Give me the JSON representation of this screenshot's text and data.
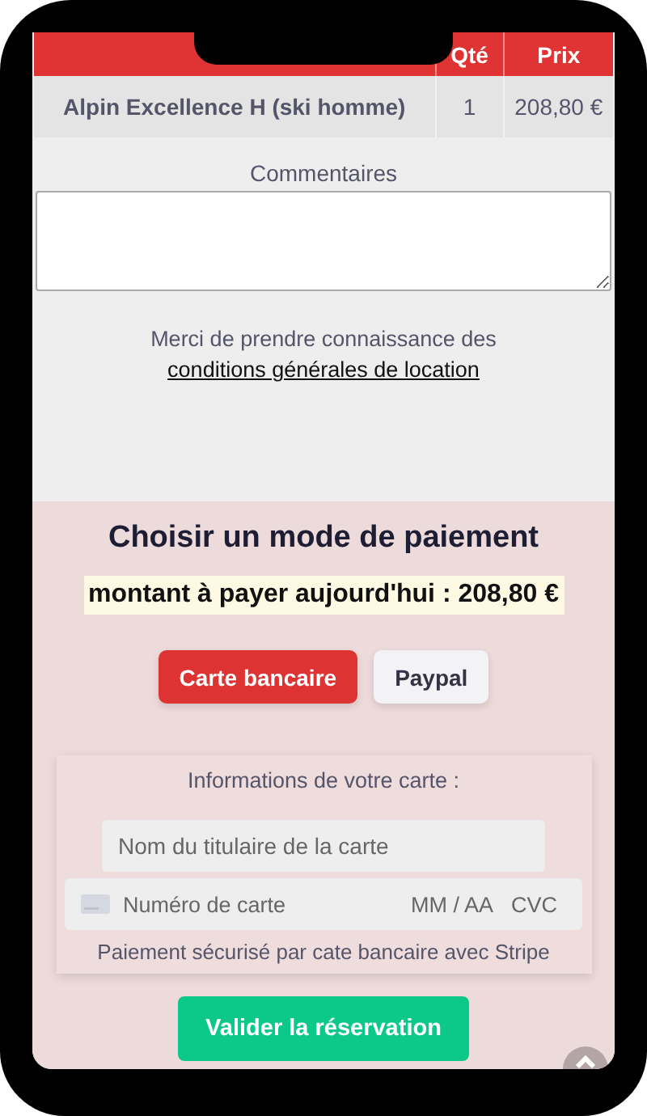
{
  "order_table": {
    "columns": [
      "Qté",
      "Prix"
    ],
    "rows": [
      {
        "product": "Alpin Excellence H (ski homme)",
        "quantity": "1",
        "price": "208,80 €"
      }
    ]
  },
  "comments": {
    "label": "Commentaires"
  },
  "terms": {
    "text": "Merci de prendre connaissance des",
    "link": "conditions générales de location"
  },
  "payment": {
    "title": "Choisir un mode de paiement",
    "amount": "montant à payer aujourd'hui : 208,80 €",
    "methods": [
      {
        "label": "Carte bancaire",
        "selected": true
      },
      {
        "label": "Paypal",
        "selected": false
      }
    ],
    "card": {
      "heading": "Informations de votre carte :",
      "holder_placeholder": "Nom du titulaire de la carte",
      "number_placeholder": "Numéro de carte",
      "expiry_placeholder": "MM / AA",
      "cvc_placeholder": "CVC",
      "note": "Paiement sécurisé par cate bancaire avec Stripe"
    },
    "submit": "Valider la réservation"
  }
}
